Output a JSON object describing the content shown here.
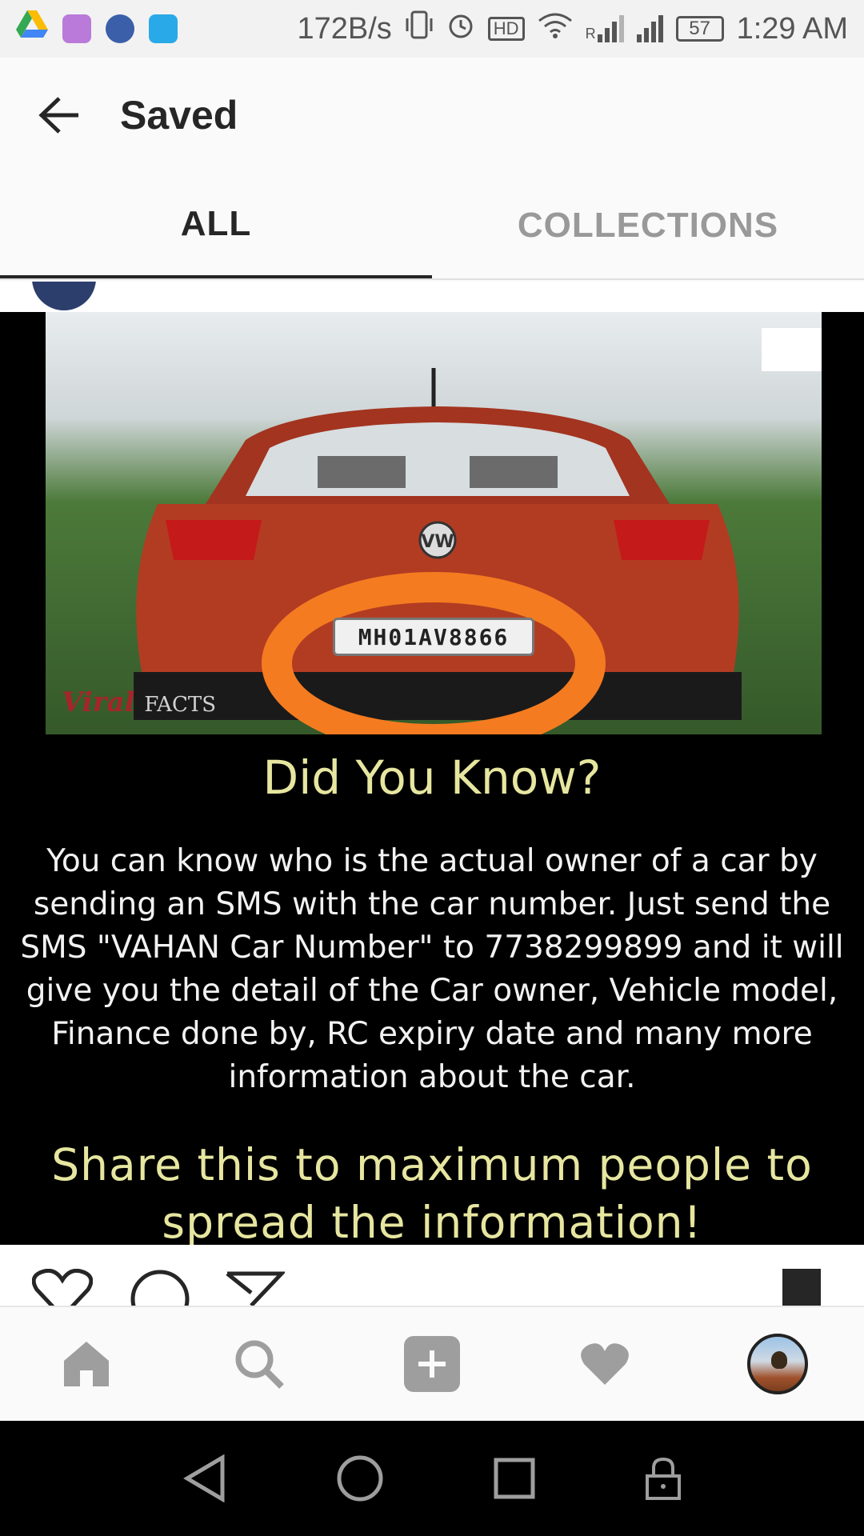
{
  "status_bar": {
    "network_speed": "172B/s",
    "hd_badge": "HD",
    "network_label": "R",
    "battery": "57",
    "time": "1:29 AM",
    "icons": [
      "google-drive-icon",
      "gallery-app-icon",
      "tv-app-icon",
      "alexa-app-icon",
      "vibrate-icon",
      "alarm-icon",
      "hd-icon",
      "wifi-icon",
      "signal-icon",
      "battery-icon"
    ]
  },
  "app_bar": {
    "title": "Saved"
  },
  "tabs": [
    {
      "label": "ALL",
      "active": true
    },
    {
      "label": "COLLECTIONS",
      "active": false
    }
  ],
  "post": {
    "plate_text": "MH01AV8866",
    "watermark_script": "Viral",
    "watermark_rest": "FACTS",
    "heading": "Did You Know?",
    "body": "You can know who is the actual owner of a car by sending an SMS with the car number. Just send the SMS \"VAHAN Car Number\" to 7738299899 and it will give you the detail of the Car owner, Vehicle model, Finance done by, RC expiry date and many more information about the car.",
    "share_line_1": "Share this to maximum people to",
    "share_line_2": "spread the information!"
  },
  "bottom_nav": [
    "home-icon",
    "search-icon",
    "add-post-icon",
    "activity-heart-icon",
    "profile-avatar"
  ],
  "system_nav": [
    "back-triangle-icon",
    "home-circle-icon",
    "recents-square-icon",
    "lock-icon"
  ],
  "colors": {
    "accent_text": "#262626",
    "inactive_tab": "#999999",
    "highlight_ring": "#f47b20",
    "post_heading": "#e6e6a0"
  }
}
